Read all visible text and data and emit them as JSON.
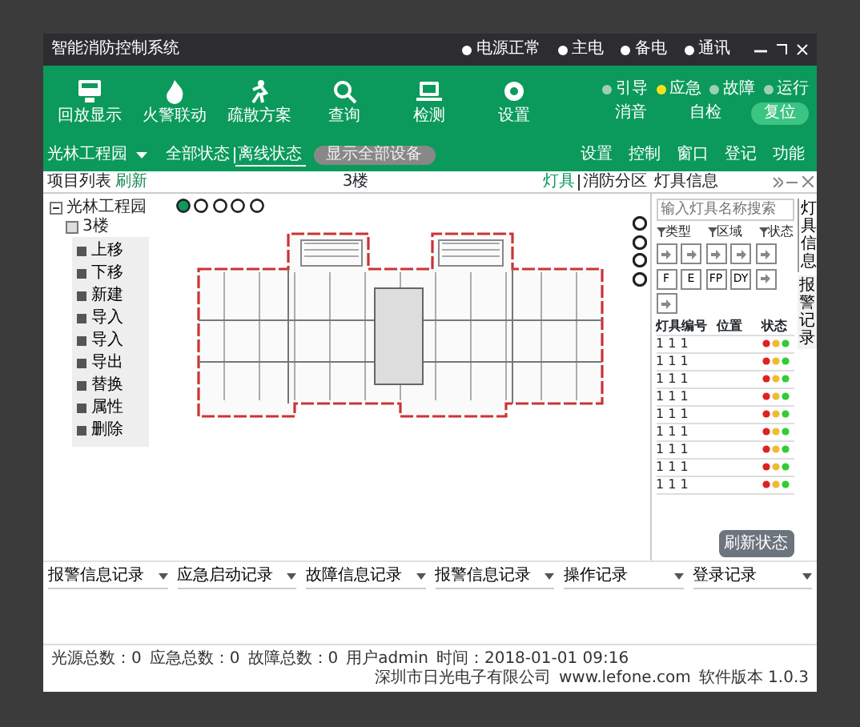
{
  "window": {
    "title": "智能消防控制系统",
    "status_items": [
      {
        "label": "电源正常"
      },
      {
        "label": "主电"
      },
      {
        "label": "备电"
      },
      {
        "label": "通讯"
      }
    ]
  },
  "toolbar": [
    {
      "label": "回放显示"
    },
    {
      "label": "火警联动"
    },
    {
      "label": "疏散方案"
    },
    {
      "label": "查询"
    },
    {
      "label": "检测"
    },
    {
      "label": "设置"
    }
  ],
  "indicators": [
    {
      "label": "引导",
      "on": false
    },
    {
      "label": "应急",
      "on": true
    },
    {
      "label": "故障",
      "on": false
    },
    {
      "label": "运行",
      "on": false
    }
  ],
  "actions": [
    {
      "label": "消音",
      "selected": false
    },
    {
      "label": "自检",
      "selected": false
    },
    {
      "label": "复位",
      "selected": true
    }
  ],
  "project_selector": {
    "value": "光林工程园"
  },
  "view_tabs": [
    {
      "label": "全部状态",
      "selected": false
    },
    {
      "label": "离线状态",
      "selected": true
    }
  ],
  "filter_pill": "显示全部设备",
  "menu": [
    "设置",
    "控制",
    "窗口",
    "登记",
    "功能"
  ],
  "panel_headers": {
    "left": "项目列表",
    "left_action": "刷新",
    "center": "3楼",
    "right_tabs": [
      {
        "label": "灯具",
        "selected": true
      },
      {
        "label": "消防分区",
        "selected": false
      }
    ],
    "info": "灯具信息"
  },
  "tree": [
    {
      "label": "光林工程园",
      "expanded": true,
      "children": [
        {
          "label": "3楼"
        }
      ]
    }
  ],
  "context_menu": [
    "上移",
    "下移",
    "新建",
    "导入",
    "导入",
    "导出",
    "替换",
    "属性",
    "删除"
  ],
  "lamp_panel": {
    "search": {
      "placeholder": "输入灯具名称搜索"
    },
    "filters": [
      "类型",
      "区域",
      "状态"
    ],
    "tool_buttons": [
      {
        "kind": "icon"
      },
      {
        "kind": "icon"
      },
      {
        "kind": "icon"
      },
      {
        "kind": "icon"
      },
      {
        "kind": "icon"
      },
      {
        "kind": "letter",
        "label": "F"
      },
      {
        "kind": "letter",
        "label": "E"
      },
      {
        "kind": "letter",
        "label": "FP"
      },
      {
        "kind": "letter",
        "label": "DY"
      },
      {
        "kind": "icon"
      },
      {
        "kind": "icon"
      }
    ],
    "columns": [
      "灯具编号",
      "位置",
      "状态"
    ],
    "rows": [
      {
        "number": "1 1 1"
      },
      {
        "number": "1 1 1"
      },
      {
        "number": "1 1 1"
      },
      {
        "number": "1 1 1"
      },
      {
        "number": "1 1 1"
      },
      {
        "number": "1 1 1"
      },
      {
        "number": "1 1 1"
      },
      {
        "number": "1 1 1"
      },
      {
        "number": "1 1 1"
      }
    ],
    "refresh_button": "刷新状态"
  },
  "side_tabs": [
    {
      "label": "灯具信息",
      "selected": true
    },
    {
      "label": "报警记录",
      "selected": false
    }
  ],
  "log_tabs": [
    "报警信息记录",
    "应急启动记录",
    "故障信息记录",
    "报警信息记录",
    "操作记录",
    "登录记录"
  ],
  "status_bar": {
    "left": [
      "光源总数：0",
      "应急总数：0",
      "故障总数：0",
      "用户admin",
      "时间：2018-01-01 09:16"
    ],
    "right": [
      "深圳市日光电子有限公司",
      "www.lefone.com",
      "软件版本 1.0.3"
    ]
  }
}
